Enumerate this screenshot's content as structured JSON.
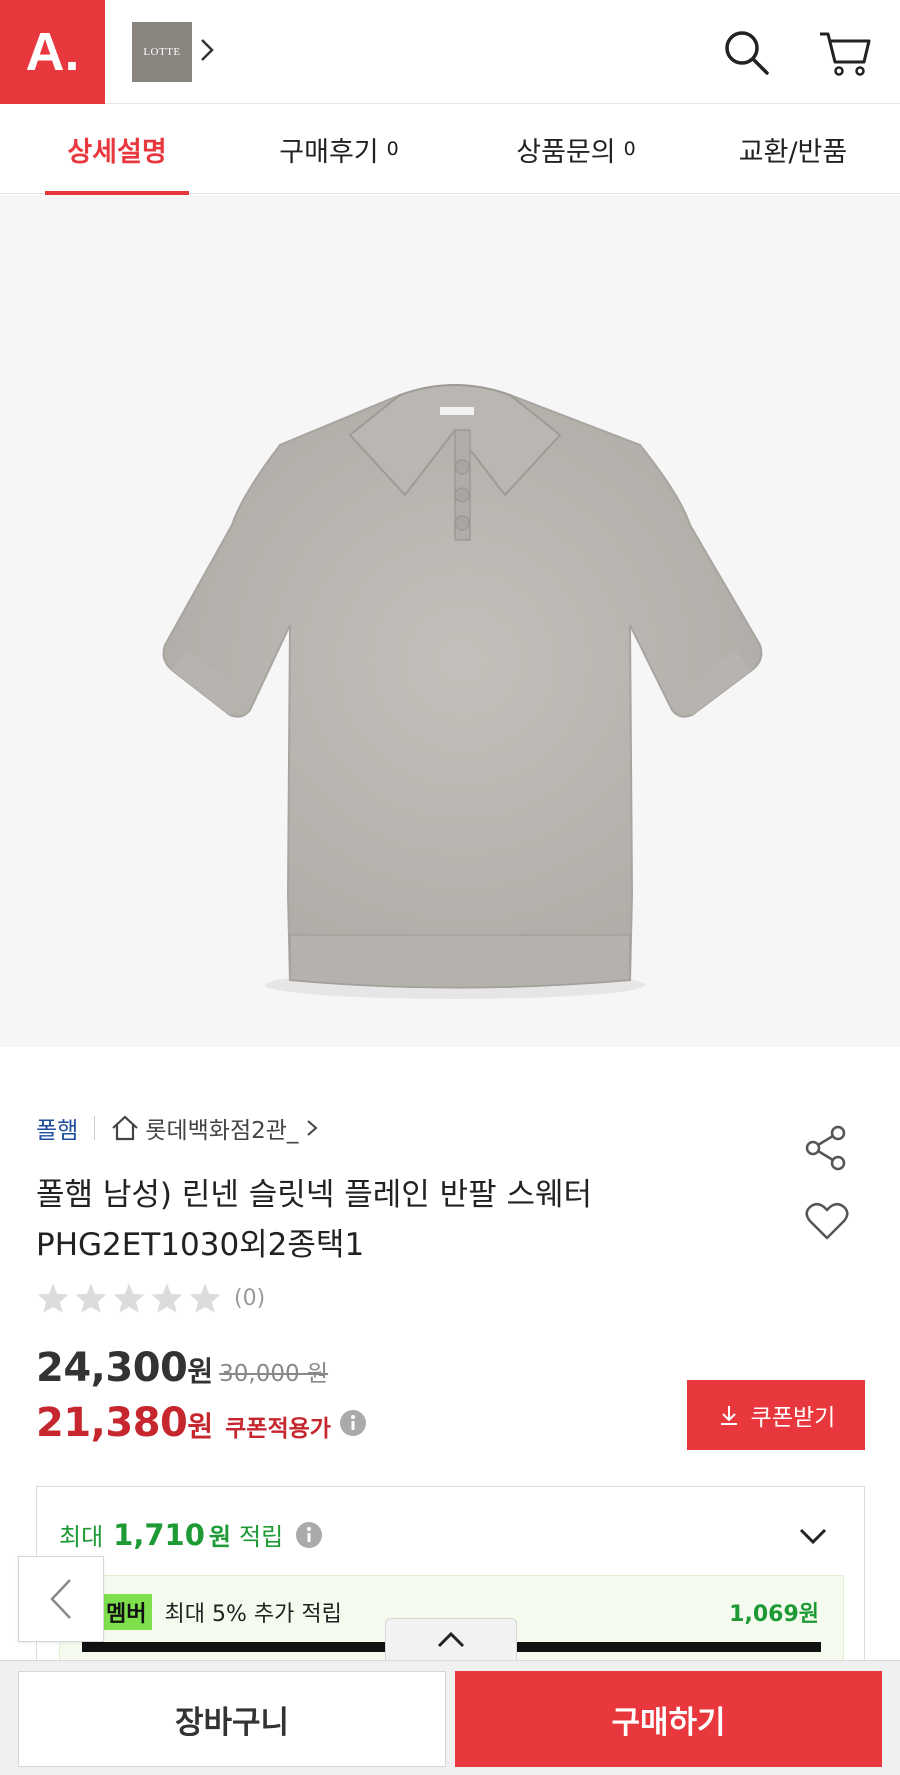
{
  "header": {
    "logo_text": "A.",
    "brand_logo_text": "LOTTE",
    "brand_color": "#e8383d"
  },
  "tabs": [
    {
      "label": "상세설명",
      "count": ""
    },
    {
      "label": "구매후기",
      "count": "0"
    },
    {
      "label": "상품문의",
      "count": "0"
    },
    {
      "label": "교환/반품",
      "count": ""
    }
  ],
  "product": {
    "brand": "폴햄",
    "store": "롯데백화점2관_",
    "title_line1": "폴햄 남성) 린넨 슬릿넥 플레인 반팔 스웨터",
    "title_line2": "PHG2ET1030외2종택1",
    "rating_count": "(0)",
    "rating_stars": 0,
    "price": "24,300",
    "price_unit": "원",
    "original_price": "30,000 원",
    "coupon_price": "21,380",
    "coupon_price_unit": "원",
    "coupon_label": "쿠폰적용가",
    "coupon_button": "쿠폰받기"
  },
  "points": {
    "prefix": "최대",
    "amount": "1,710",
    "unit": "원",
    "suffix": "적립",
    "member_badge": "멤버",
    "member_text": "최대 5% 추가 적립",
    "member_amount": "1,069원"
  },
  "bottom": {
    "cart_label": "장바구니",
    "buy_label": "구매하기"
  }
}
